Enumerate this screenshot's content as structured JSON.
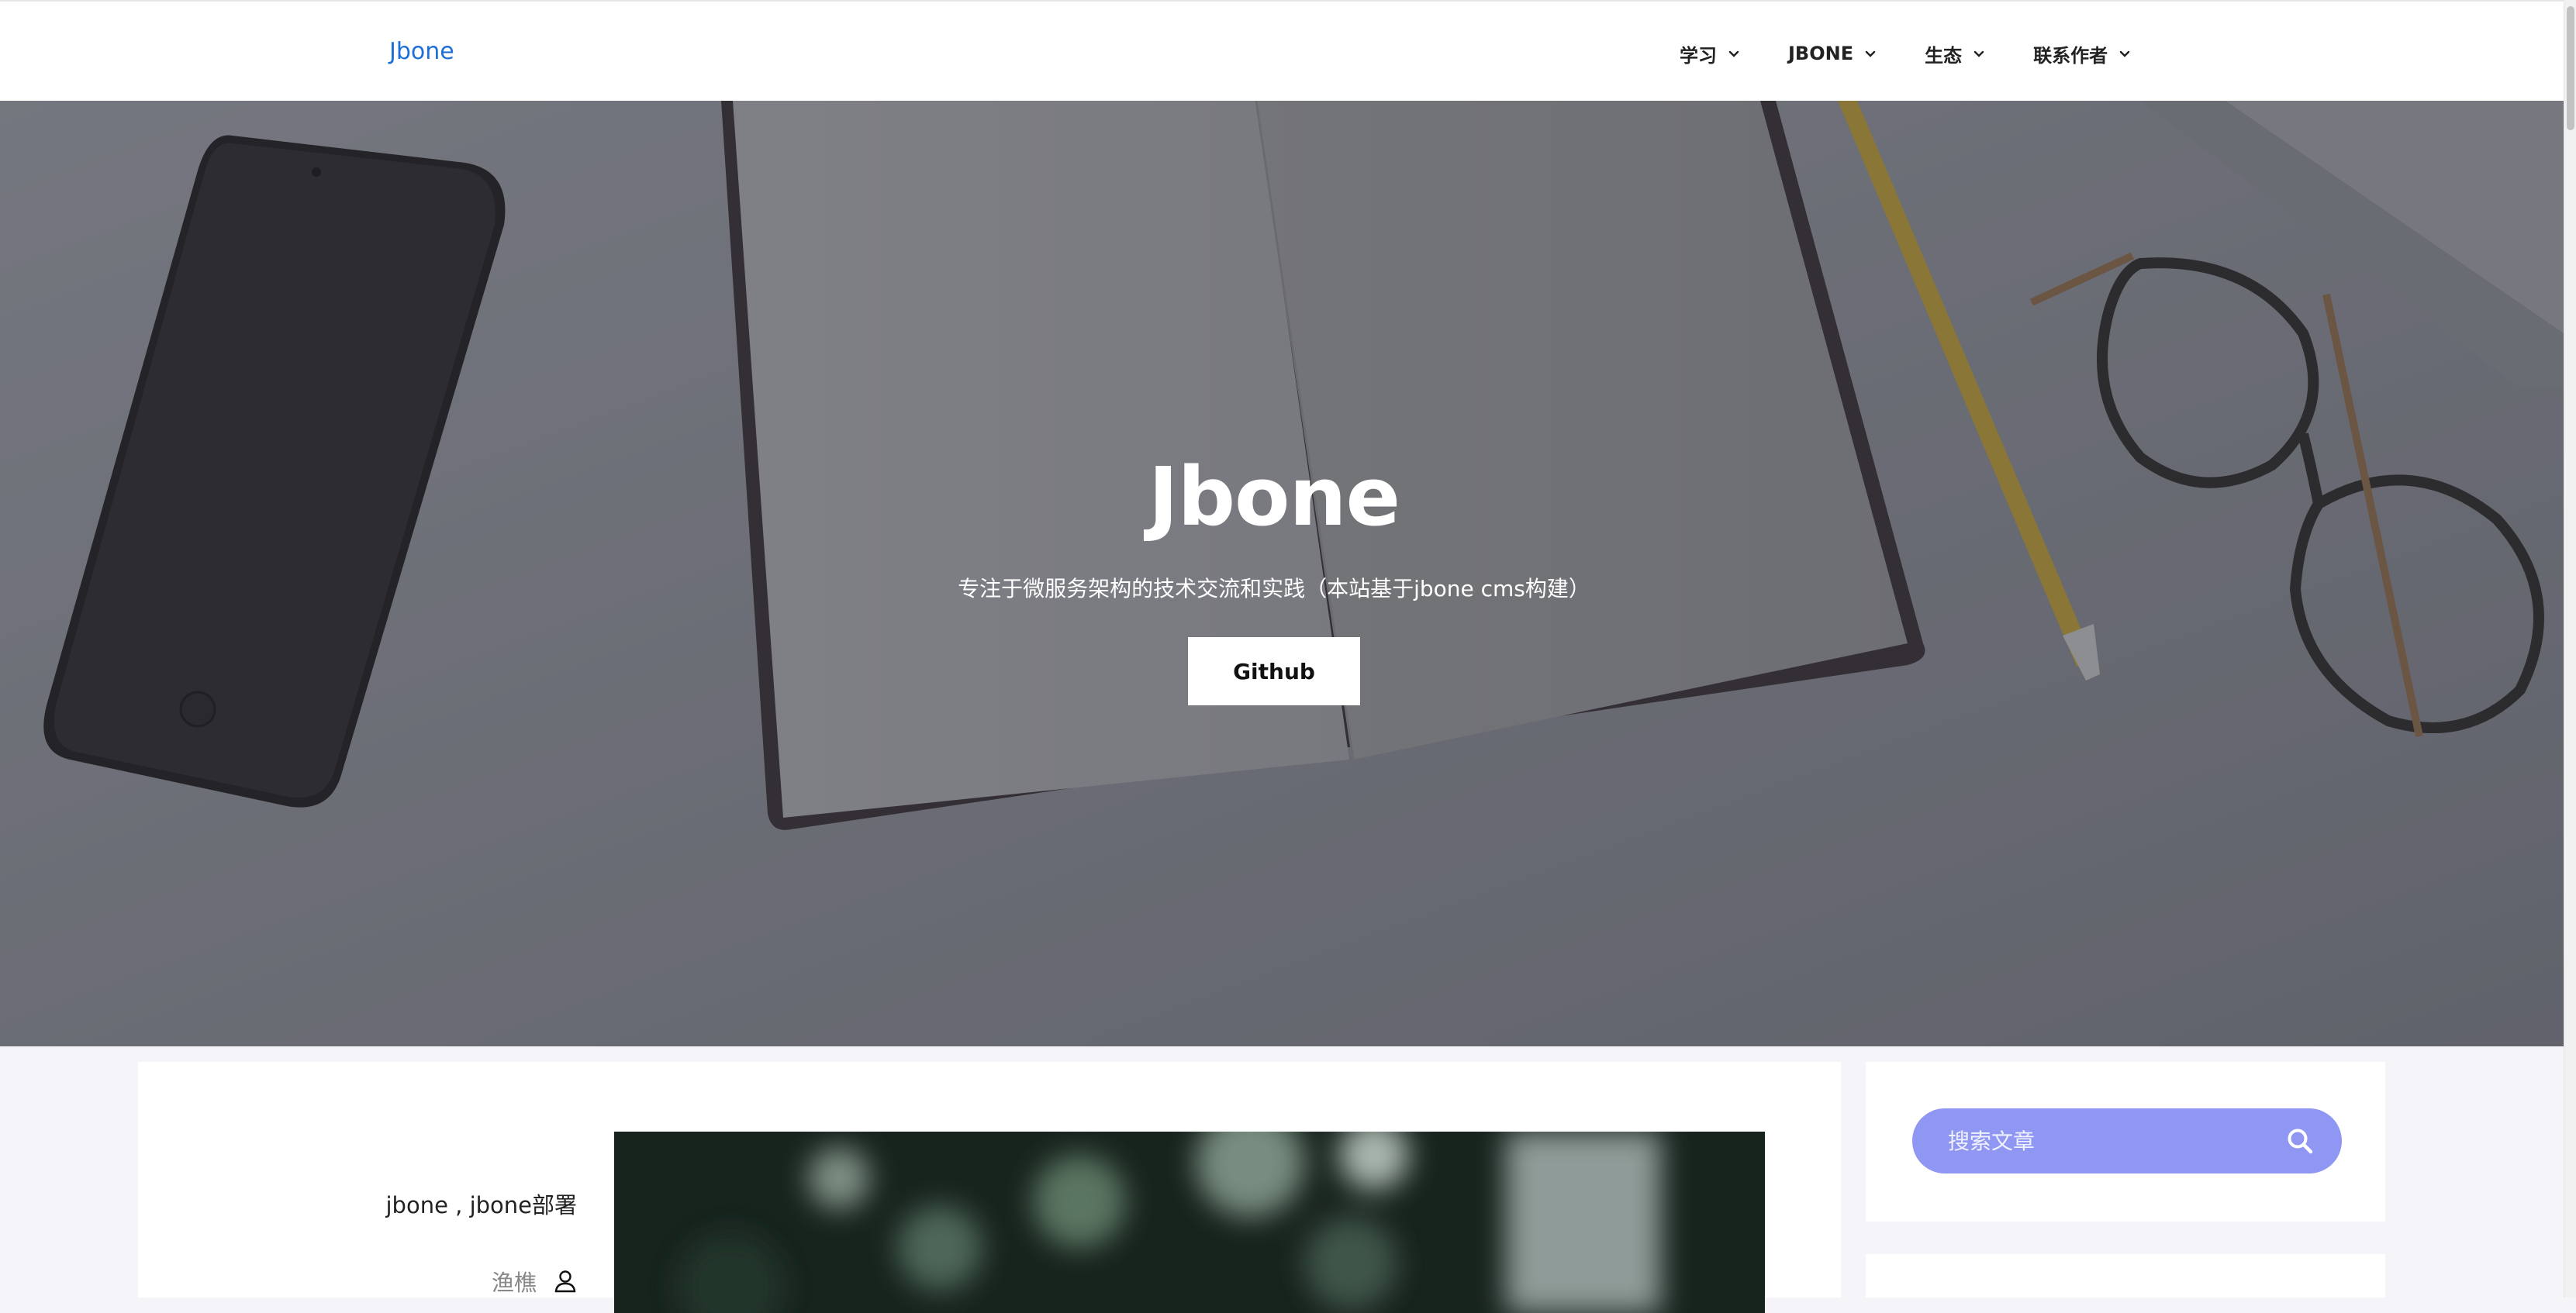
{
  "site": {
    "brand": "Jbone"
  },
  "nav": {
    "items": [
      {
        "label": "学习"
      },
      {
        "label": "JBONE"
      },
      {
        "label": "生态"
      },
      {
        "label": "联系作者"
      }
    ]
  },
  "hero": {
    "title": "Jbone",
    "subtitle": "专注于微服务架构的技术交流和实践（本站基于jbone cms构建）",
    "button_label": "Github"
  },
  "post": {
    "tags": "jbone , jbone部署",
    "author": "渔樵"
  },
  "sidebar": {
    "search_placeholder": "搜索文章"
  },
  "colors": {
    "brand": "#1f6fd8",
    "search_bg": "#8f97f2"
  }
}
